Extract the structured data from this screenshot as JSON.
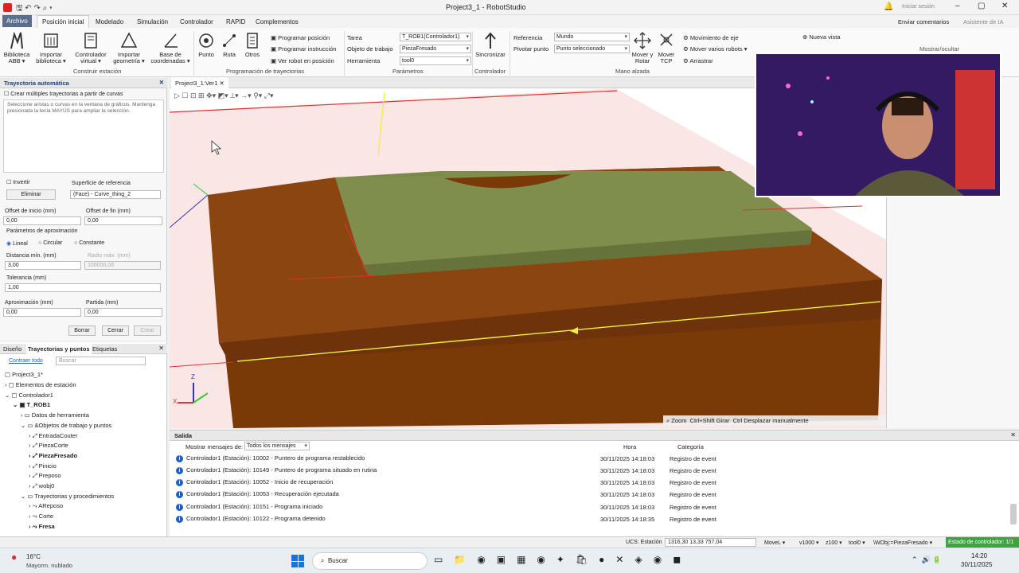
{
  "titlebar": {
    "title": "Project3_1 - RobotStudio",
    "signin": "Iniciar sesión"
  },
  "ribbon_tabs": [
    "Archivo",
    "Posición inicial",
    "Modelado",
    "Simulación",
    "Controlador",
    "RAPID",
    "Complementos"
  ],
  "ribbon_right": {
    "feedback": "Enviar comentarios",
    "ia": "Asistente de IA"
  },
  "construir": {
    "group": "Construir estación",
    "items": [
      "Biblioteca ABB ▾",
      "Importar biblioteca ▾",
      "Controlador virtual ▾",
      "Importar geometría ▾",
      "Base de coordenadas ▾"
    ]
  },
  "programacion": {
    "group": "Programación de trayectorias",
    "items": [
      "Punto",
      "Ruta",
      "Otros"
    ],
    "actions": [
      "Programar posición",
      "Programar instrucción",
      "Ver robot en posición"
    ]
  },
  "parametros": {
    "group": "Parámetros",
    "tarea_label": "Tarea",
    "tarea": "T_ROB1(Controlador1)",
    "objeto_label": "Objeto de trabajo",
    "objeto": "PiezaFresado",
    "herr_label": "Herramienta",
    "herr": "tool0"
  },
  "controlador": {
    "group": "Controlador",
    "sync": "Sincronizar"
  },
  "mano": {
    "group": "Mano alzada",
    "ref_label": "Referencia",
    "ref": "Mundo",
    "piv_label": "Pivotar punto",
    "piv": "Punto seleccionado",
    "mover": "Mover y Rotar",
    "tcp": "Mover TCP",
    "mov_eje": "Movimiento de eje",
    "mover_varios": "Mover varios robots ▾",
    "arrastrar": "Arrastrar",
    "nueva_vista": "Nueva vista",
    "mostrar": "Mostrar/ocultar"
  },
  "auto": {
    "title": "Trayectoria automática",
    "multi": "Crear múltiples trayectorias a partir de curvas",
    "hint": "Seleccione aristas o curvas en la ventana de gráficos. Mantenga presionada la tecla MAYÚS para ampliar la selección.",
    "invertir": "Invertir",
    "eliminar": "Eliminar",
    "ref_label": "Superficie de referencia",
    "ref_value": "(Face) - Curve_thing_2",
    "offset_ini_label": "Offset de inicio (mm)",
    "offset_ini": "0,00",
    "offset_fin_label": "Offset de fin (mm)",
    "offset_fin": "0,00",
    "aprox_params": "Parámetros de aproximación",
    "lineal": "Lineal",
    "circular": "Circular",
    "constante": "Constante",
    "dist_label": "Distancia mín. (mm)",
    "dist": "3,00",
    "radio_label": "Radio máx. (mm)",
    "radio": "100000,00",
    "tol_label": "Tolerancia (mm)",
    "tol": "1,00",
    "aprox_label": "Aproximación (mm)",
    "aprox": "0,00",
    "partida_label": "Partida (mm)",
    "partida": "0,00",
    "borrar": "Borrar",
    "cerrar": "Cerrar",
    "crear": "Crear"
  },
  "tree": {
    "tabs": [
      "Diseño",
      "Trayectorias y puntos",
      "Etiquetas"
    ],
    "collapse": "Contraer todo",
    "search": "Buscar",
    "nodes": [
      "Project3_1*",
      "Elementos de estación",
      "Controlador1",
      "T_ROB1",
      "Datos de herramienta",
      "&Objetos de trabajo y puntos",
      "EntradaCouter",
      "PiezaCorte",
      "PiezaFresado",
      "Pinicio",
      "Preposo",
      "wobj0",
      "Trayectorias y procedimientos",
      "AReposo",
      "Corte",
      "Fresa"
    ]
  },
  "viewport": {
    "tab": "Project3_1:Ver1",
    "zoom": "Zoom",
    "girar": "Girar",
    "desplazar": "Desplazar manualmente"
  },
  "output": {
    "title": "Salida",
    "filter_label": "Mostrar mensajes de:",
    "filter": "Todos los mensajes",
    "col_hora": "Hora",
    "col_cat": "Categoría",
    "rows": [
      {
        "msg": "Controlador1 (Estación): 10002 - Puntero de programa restablecido",
        "time": "30/11/2025 14:18:03",
        "cat": "Registro de event"
      },
      {
        "msg": "Controlador1 (Estación): 10149 - Puntero de programa situado en rutina",
        "time": "30/11/2025 14:18:03",
        "cat": "Registro de event"
      },
      {
        "msg": "Controlador1 (Estación): 10052 - Inicio de recuperación",
        "time": "30/11/2025 14:18:03",
        "cat": "Registro de event"
      },
      {
        "msg": "Controlador1 (Estación): 10053 - Recuperación ejecutada",
        "time": "30/11/2025 14:18:03",
        "cat": "Registro de event"
      },
      {
        "msg": "Controlador1 (Estación): 10151 - Programa iniciado",
        "time": "30/11/2025 14:18:03",
        "cat": "Registro de event"
      },
      {
        "msg": "Controlador1 (Estación): 10122 - Programa detenido",
        "time": "30/11/2025 14:18:35",
        "cat": "Registro de event"
      }
    ]
  },
  "status": {
    "ucs_label": "UCS: Estación",
    "ucs": "1316,30  13,33  757,04",
    "movel": "MoveL ▾",
    "v": "v1000 ▾",
    "z": "z100 ▾",
    "tool": "tool0 ▾",
    "wobj": "\\WObj:=PiezaFresado ▾",
    "ctrl": "Estado de controlador: 1/1"
  },
  "taskbar": {
    "temp": "16°C",
    "weather": "Mayorm. nublado",
    "search": "Buscar",
    "time": "14:20",
    "date": "30/11/2025"
  },
  "colors": {
    "accent": "#1f3e74",
    "box": "#7a3a08",
    "plate": "#7b8a4a",
    "status_green": "#3fa43f"
  }
}
